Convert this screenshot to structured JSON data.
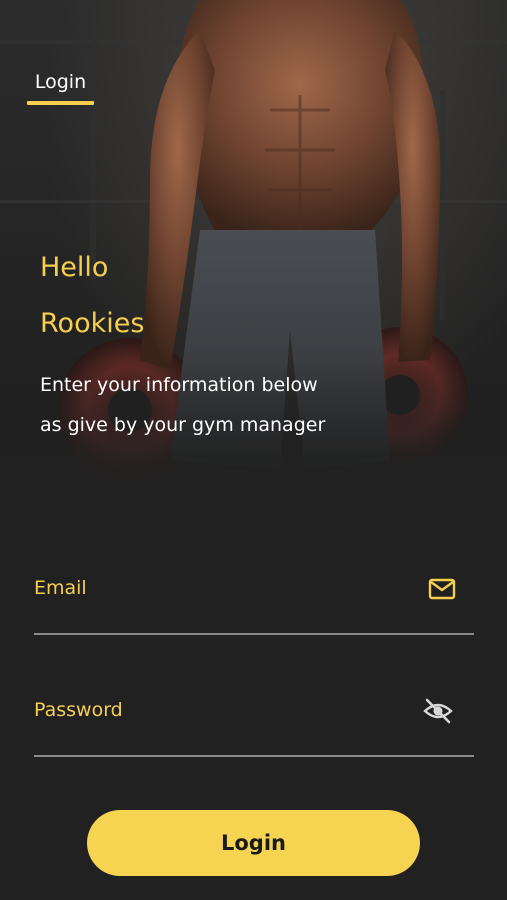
{
  "tabs": [
    {
      "label": "Login",
      "active": true
    }
  ],
  "greeting": {
    "line1": "Hello",
    "line2": "Rookies"
  },
  "subtitle": {
    "line1": "Enter your information below",
    "line2": "as give by your gym manager"
  },
  "form": {
    "email": {
      "placeholder": "Email",
      "value": "",
      "icon": "mail-icon"
    },
    "password": {
      "placeholder": "Password",
      "value": "",
      "icon": "eye-off-icon"
    }
  },
  "actions": {
    "login_label": "Login"
  },
  "colors": {
    "accent": "#f6cf4f",
    "button": "#f6d452",
    "background": "#212121",
    "text": "#ffffff",
    "divider": "#8a8a8a"
  }
}
